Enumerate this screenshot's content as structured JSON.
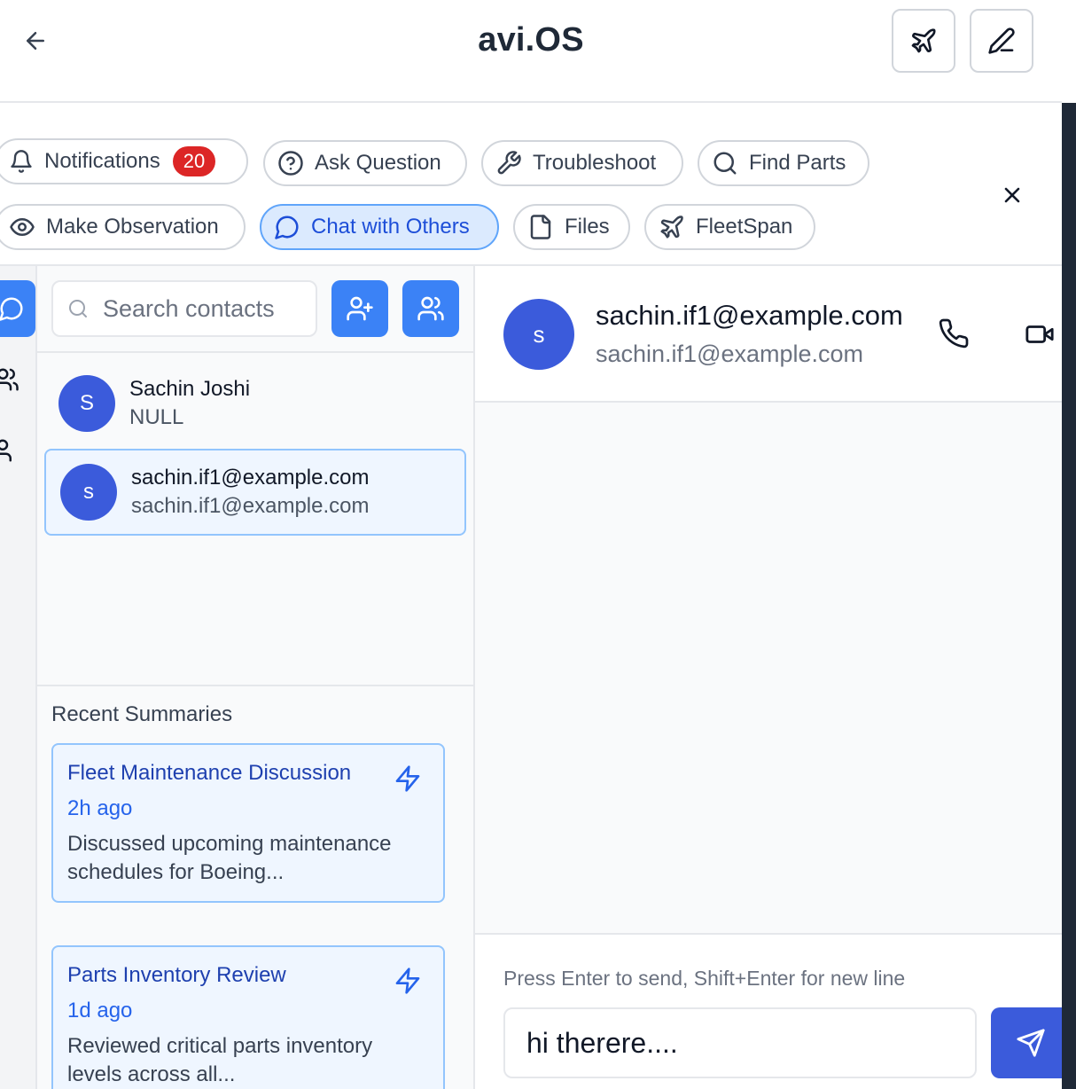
{
  "header": {
    "title": "avi.OS",
    "back_icon": "arrow-left-icon",
    "actions": [
      {
        "name": "flight-button",
        "icon": "plane-icon"
      },
      {
        "name": "edit-button",
        "icon": "pencil-icon"
      }
    ]
  },
  "chips": {
    "row1": [
      {
        "label": "Notifications",
        "icon": "bell-icon",
        "badge": "20"
      },
      {
        "label": "Ask Question",
        "icon": "help-circle-icon"
      },
      {
        "label": "Troubleshoot",
        "icon": "wrench-icon"
      },
      {
        "label": "Find Parts",
        "icon": "search-icon"
      }
    ],
    "row2": [
      {
        "label": "Make Observation",
        "icon": "eye-icon"
      },
      {
        "label": "Chat with Others",
        "icon": "chat-bubble-icon",
        "active": true
      },
      {
        "label": "Files",
        "icon": "file-icon"
      },
      {
        "label": "FleetSpan",
        "icon": "plane-icon"
      }
    ]
  },
  "contacts": {
    "search_placeholder": "Search contacts",
    "list": [
      {
        "initial": "S",
        "name": "Sachin Joshi",
        "sub": "NULL",
        "selected": false
      },
      {
        "initial": "s",
        "name": "sachin.if1@example.com",
        "sub": "sachin.if1@example.com",
        "selected": true
      }
    ]
  },
  "summaries": {
    "title": "Recent Summaries",
    "items": [
      {
        "title": "Fleet Maintenance Discussion",
        "time": "2h ago",
        "desc": "Discussed upcoming maintenance schedules for Boeing..."
      },
      {
        "title": "Parts Inventory Review",
        "time": "1d ago",
        "desc": "Reviewed critical parts inventory levels across all..."
      }
    ]
  },
  "chat": {
    "avatar_initial": "s",
    "name": "sachin.if1@example.com",
    "email": "sachin.if1@example.com",
    "hint": "Press Enter to send, Shift+Enter for new line",
    "message_value": "hi therere...."
  },
  "colors": {
    "accent": "#3b82f6",
    "avatar": "#3b5bdb",
    "badge": "#dc2626",
    "active_chip_bg": "#dbeafe"
  }
}
